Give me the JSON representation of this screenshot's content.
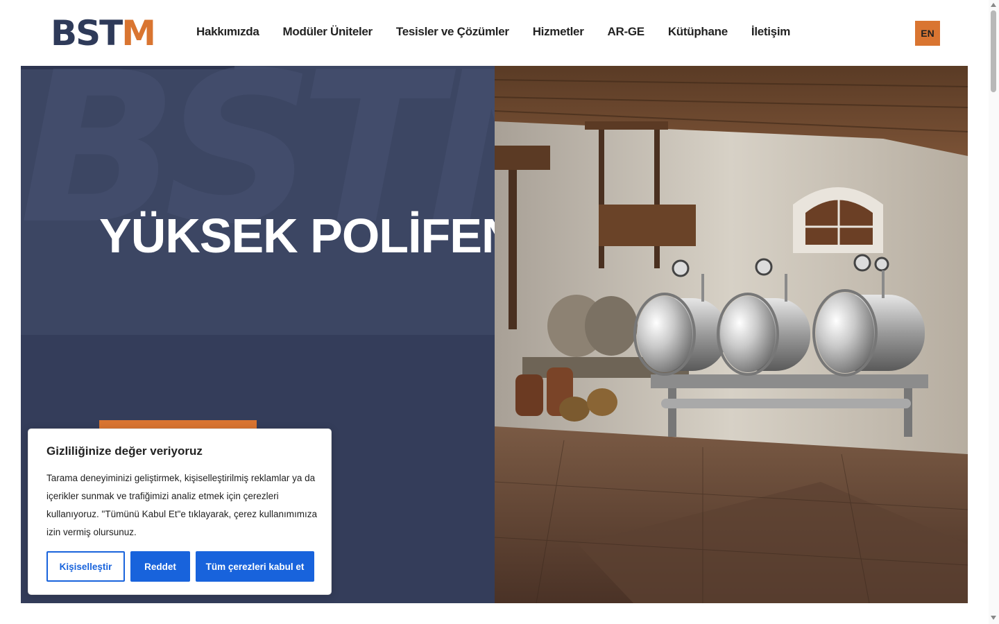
{
  "header": {
    "logo_dark": "BST",
    "logo_accent": "M",
    "nav": [
      "Hakkımızda",
      "Modüler Üniteler",
      "Tesisler ve Çözümler",
      "Hizmetler",
      "AR-GE",
      "Kütüphane",
      "İletişim"
    ],
    "lang_label": "EN"
  },
  "hero": {
    "watermark": "BSTM",
    "title": "YÜKSEK POLİFENOL",
    "image_alt": "Olive oil mill with stainless steel tanks"
  },
  "cookie": {
    "title": "Gizliliğinize değer veriyoruz",
    "body": "Tarama deneyiminizi geliştirmek, kişiselleştirilmiş reklamlar ya da içerikler sunmak ve trafiğimizi analiz etmek için çerezleri kullanıyoruz. \"Tümünü Kabul Et\"e tıklayarak, çerez kullanımımıza izin vermiş olursunuz.",
    "customize_label": "Kişiselleştir",
    "reject_label": "Reddet",
    "accept_label": "Tüm çerezleri kabul et"
  },
  "colors": {
    "brand_dark": "#2e3a59",
    "brand_accent": "#d97531",
    "hero_panel": "#343d5a",
    "cookie_button": "#1863dc"
  }
}
